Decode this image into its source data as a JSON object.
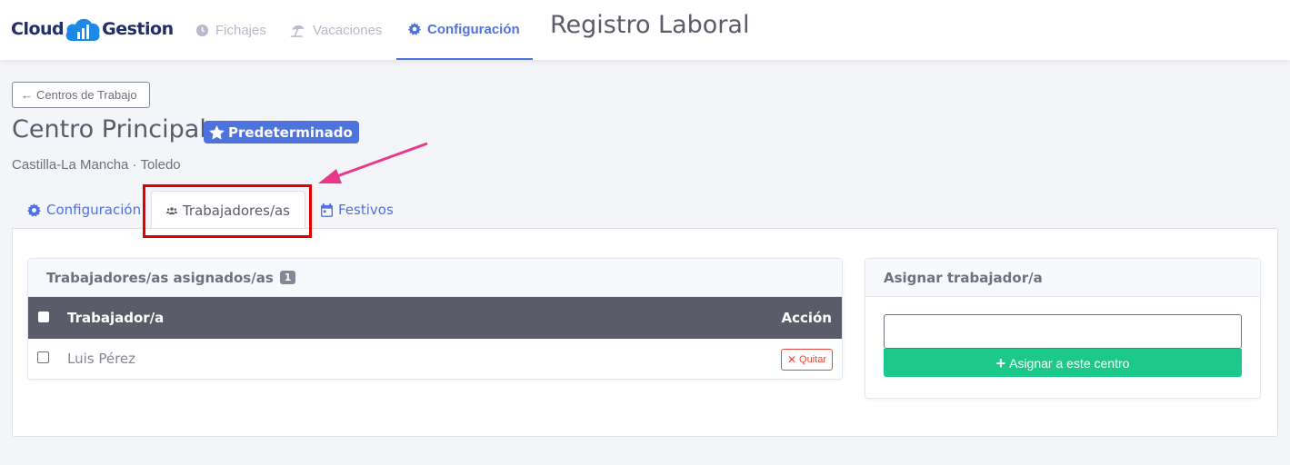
{
  "brand": {
    "left": "Cloud",
    "right": "Gestion"
  },
  "nav": {
    "items": [
      {
        "label": "Fichajes",
        "icon": "clock-icon"
      },
      {
        "label": "Vacaciones",
        "icon": "beach-umbrella-icon"
      },
      {
        "label": "Configuración",
        "icon": "gear-icon",
        "active": true
      }
    ],
    "app_title": "Registro Laboral"
  },
  "back_button": {
    "label": "Centros de Trabajo"
  },
  "center": {
    "title": "Centro Principal",
    "badge": "Predeterminado",
    "location": "Castilla-La Mancha · Toledo"
  },
  "tabs": [
    {
      "label": "Configuración",
      "icon": "gear-icon"
    },
    {
      "label": "Trabajadores/as",
      "icon": "users-icon",
      "active": true
    },
    {
      "label": "Festivos",
      "icon": "calendar-icon"
    }
  ],
  "assigned": {
    "title": "Trabajadores/as asignados/as",
    "count": "1",
    "columns": [
      "Trabajador/a",
      "Acción"
    ],
    "rows": [
      {
        "name": "Luis Pérez",
        "action": "Quitar"
      }
    ]
  },
  "assign": {
    "title": "Asignar trabajador/a",
    "input_value": "",
    "button": "Asignar a este centro"
  },
  "colors": {
    "primary": "#4e73df",
    "success": "#1cc88a",
    "danger": "#e74a3b",
    "annotation_arrow": "#e8388a",
    "annotation_box": "#e00000"
  }
}
